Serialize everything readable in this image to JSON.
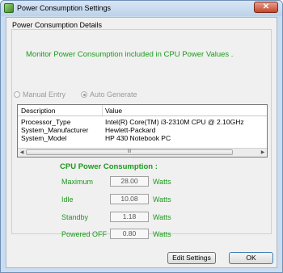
{
  "window": {
    "title": "Power Consumption Settings",
    "close_label": "✕"
  },
  "details": {
    "group_label": "Power Consumption Details",
    "monitor_text": "Monitor Power Consumption included in CPU Power Values ."
  },
  "mode": {
    "manual_label": "Manual Entry",
    "auto_label": "Auto Generate",
    "selected": "Auto Generate"
  },
  "table": {
    "columns": [
      "Description",
      "Value"
    ],
    "rows": [
      [
        "Processor_Type",
        "Intel(R) Core(TM) i3-2310M CPU @ 2.10GHz"
      ],
      [
        "System_Manufacturer",
        "Hewlett-Packard"
      ],
      [
        "System_Model",
        "HP 430 Notebook PC"
      ]
    ],
    "scroll_left": "◀",
    "scroll_right": "▶",
    "scroll_thumb": "III"
  },
  "cpu_power": {
    "title": "CPU Power Consumption :",
    "unit": "Watts",
    "items": [
      {
        "label": "Maximum",
        "value": "28.00"
      },
      {
        "label": "Idle",
        "value": "10.08"
      },
      {
        "label": "Standby",
        "value": "1.18"
      },
      {
        "label": "Powered OFF",
        "value": "0.80"
      }
    ]
  },
  "buttons": {
    "edit_label": "Edit Settings",
    "ok_label": "OK"
  },
  "colors": {
    "accent_green": "#1c9a1c",
    "close_red": "#c4452b"
  }
}
